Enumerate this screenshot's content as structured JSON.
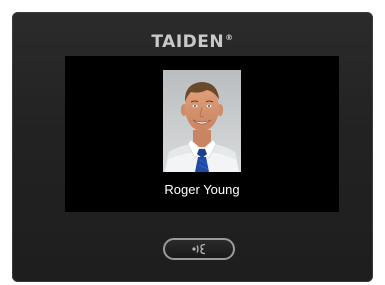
{
  "device": {
    "brand": "TAIDEN",
    "brand_mark": "®"
  },
  "screen": {
    "participant_name": "Roger Young",
    "photo": "participant-portrait"
  },
  "controls": {
    "card_button_icon": "card-reader-icon"
  },
  "colors": {
    "panel": "#222222",
    "screen": "#000000",
    "brand_text": "#c9c9c9",
    "name_text": "#ffffff",
    "button_border": "#9a9a9a"
  }
}
